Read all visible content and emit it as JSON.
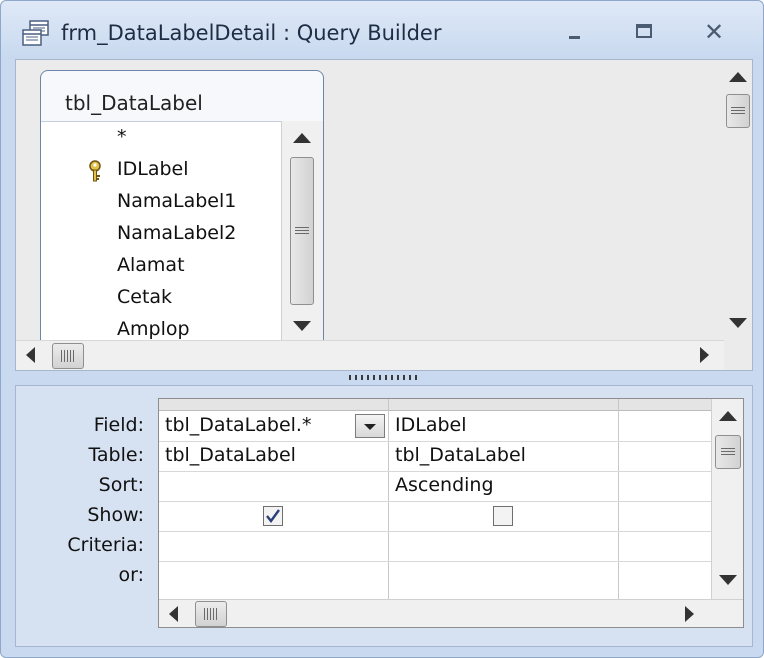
{
  "window": {
    "title": "frm_DataLabelDetail : Query Builder",
    "icon": "query-builder-icon",
    "controls": {
      "minimize": "minimize-icon",
      "maximize": "maximize-icon",
      "close": "✕"
    }
  },
  "table_box": {
    "title": "tbl_DataLabel",
    "fields": [
      {
        "label": "*"
      },
      {
        "label": "IDLabel",
        "primary_key": true
      },
      {
        "label": "NamaLabel1"
      },
      {
        "label": "NamaLabel2"
      },
      {
        "label": "Alamat"
      },
      {
        "label": "Cetak"
      },
      {
        "label": "Amplop"
      }
    ]
  },
  "grid": {
    "row_labels": {
      "field": "Field:",
      "table": "Table:",
      "sort": "Sort:",
      "show": "Show:",
      "criteria": "Criteria:",
      "or": "or:"
    },
    "columns": [
      {
        "field": "tbl_DataLabel.*",
        "table": "tbl_DataLabel",
        "sort": "",
        "show": true,
        "criteria": "",
        "or": ""
      },
      {
        "field": "IDLabel",
        "table": "tbl_DataLabel",
        "sort": "Ascending",
        "show": false,
        "criteria": "",
        "or": ""
      },
      {
        "field": "",
        "table": "",
        "sort": "",
        "show": false,
        "criteria": "",
        "or": ""
      }
    ]
  },
  "colors": {
    "frame": "#c9daf0",
    "upper_background": "#ebebeb",
    "lower_background": "#d6e2f2",
    "table_border": "#6e86a8"
  }
}
